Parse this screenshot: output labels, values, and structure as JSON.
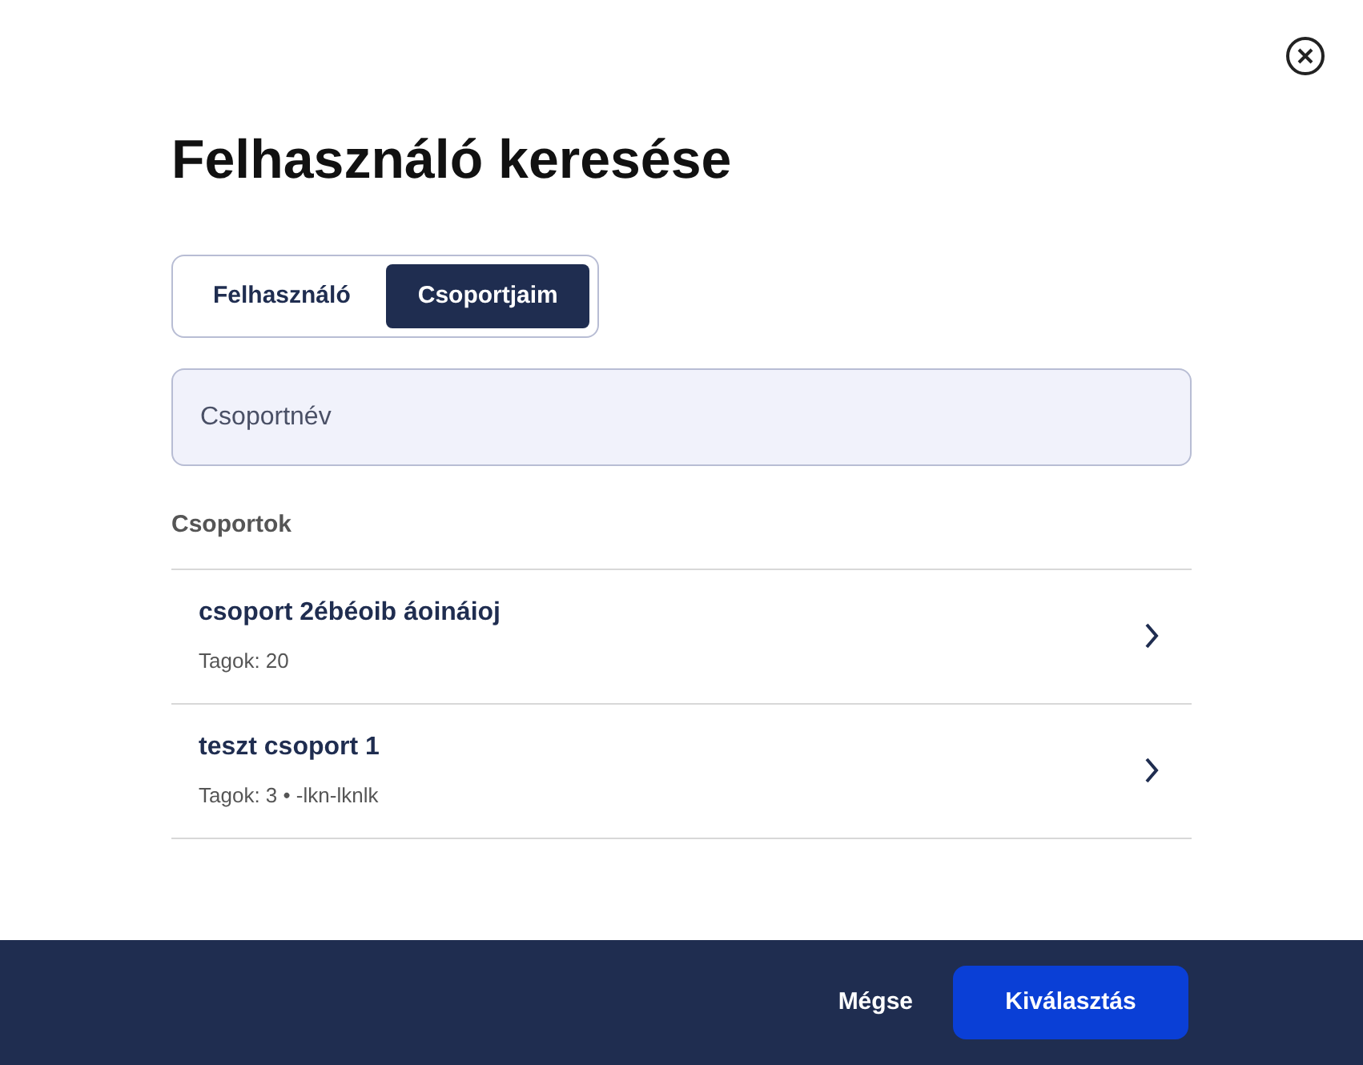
{
  "dialog": {
    "title": "Felhasználó keresése"
  },
  "tabs": [
    {
      "label": "Felhasználó",
      "selected": false
    },
    {
      "label": "Csoportjaim",
      "selected": true
    }
  ],
  "search": {
    "placeholder": "Csoportnév"
  },
  "section_label": "Csoportok",
  "groups": [
    {
      "name": "csoport 2ébéoib áoináioj",
      "meta": "Tagok: 20"
    },
    {
      "name": "teszt csoport 1",
      "meta": "Tagok: 3 • -lkn-lknlk"
    }
  ],
  "buttons": {
    "cancel": "Mégse",
    "confirm": "Kiválasztás"
  }
}
